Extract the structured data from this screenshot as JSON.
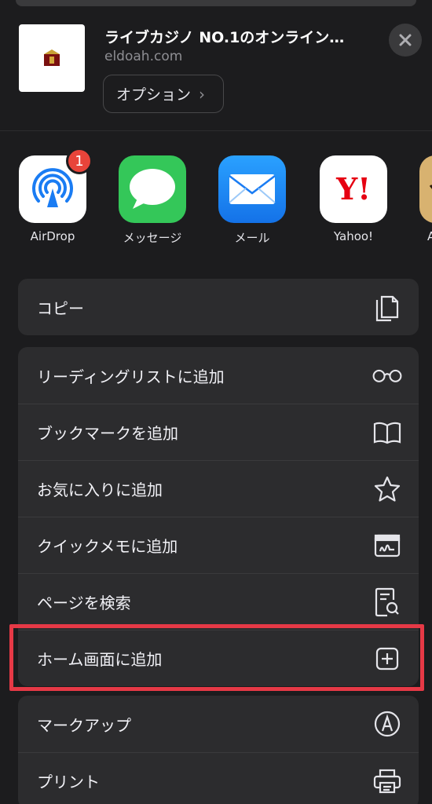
{
  "header": {
    "site_title": "ライブカジノ NO.1のオンライン…",
    "site_url": "eldoah.com",
    "options_label": "オプション",
    "options_chevron": "›",
    "close_icon": "close-icon"
  },
  "apps": [
    {
      "label": "AirDrop",
      "icon": "airdrop-icon",
      "badge": "1",
      "color": "#ffffff"
    },
    {
      "label": "メッセージ",
      "icon": "messages-icon",
      "color": "#34c759"
    },
    {
      "label": "メール",
      "icon": "mail-icon",
      "color": "#1e8cf6"
    },
    {
      "label": "Yahoo!",
      "icon": "yahoo-icon",
      "color": "#ffffff"
    },
    {
      "label": "A",
      "icon": "partial-app-icon",
      "color": "#d8b270"
    }
  ],
  "group1": [
    {
      "label": "コピー",
      "icon": "copy-icon"
    }
  ],
  "group2": [
    {
      "label": "リーディングリストに追加",
      "icon": "glasses-icon"
    },
    {
      "label": "ブックマークを追加",
      "icon": "book-icon"
    },
    {
      "label": "お気に入りに追加",
      "icon": "star-icon"
    },
    {
      "label": "クイックメモに追加",
      "icon": "quick-note-icon"
    },
    {
      "label": "ページを検索",
      "icon": "find-in-page-icon"
    },
    {
      "label": "ホーム画面に追加",
      "icon": "add-square-icon"
    }
  ],
  "group3": [
    {
      "label": "マークアップ",
      "icon": "markup-pen-icon"
    },
    {
      "label": "プリント",
      "icon": "printer-icon"
    }
  ],
  "colors": {
    "sheet": "#1c1c1e",
    "row_bg": "#2c2c2e",
    "highlight": "#e63946",
    "badge": "#e8443a"
  }
}
